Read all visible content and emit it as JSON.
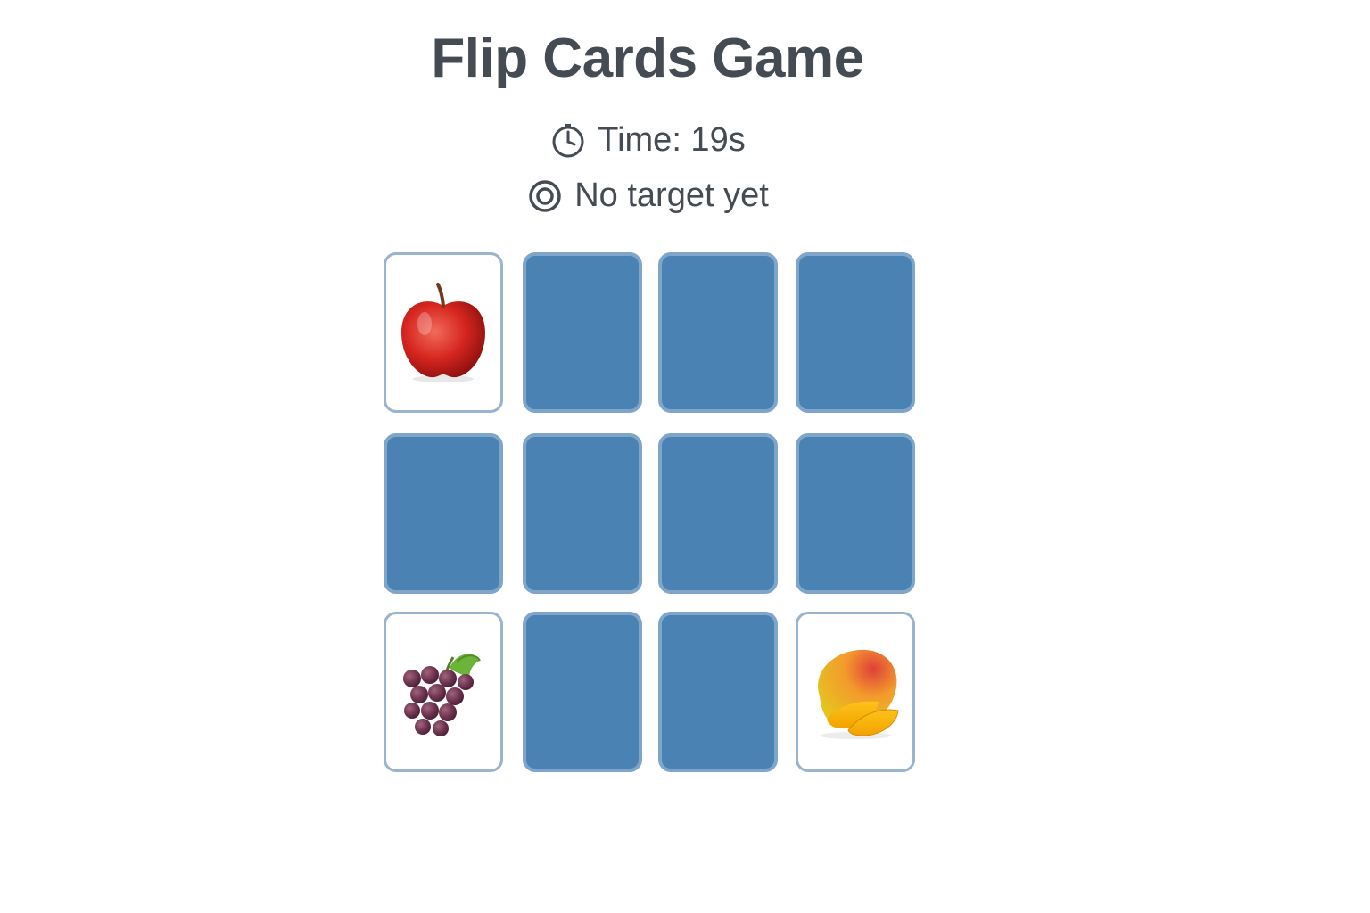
{
  "game": {
    "title": "Flip Cards Game",
    "timer_text": "Time: 19s",
    "target_text": "No target yet",
    "timer_icon": "stopwatch-icon",
    "target_icon": "target-icon"
  },
  "board": {
    "rows": 3,
    "cols": 4,
    "card_back_color": "#4a82b3",
    "cards": [
      {
        "state": "face-up",
        "fruit": "apple"
      },
      {
        "state": "face-down"
      },
      {
        "state": "face-down"
      },
      {
        "state": "face-down"
      },
      {
        "state": "face-down"
      },
      {
        "state": "face-down"
      },
      {
        "state": "face-down"
      },
      {
        "state": "face-down"
      },
      {
        "state": "face-up",
        "fruit": "grapes"
      },
      {
        "state": "face-down"
      },
      {
        "state": "face-down"
      },
      {
        "state": "face-up",
        "fruit": "mango"
      }
    ]
  }
}
